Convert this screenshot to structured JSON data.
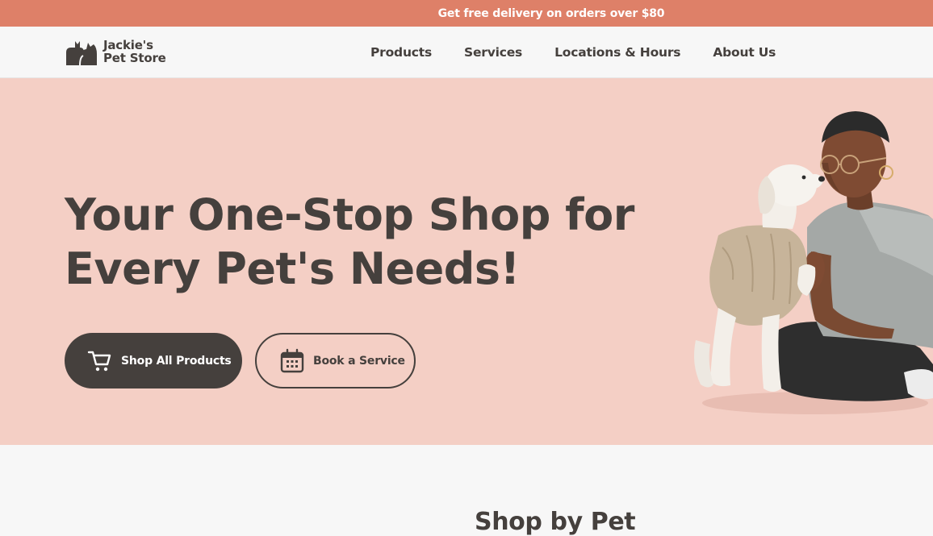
{
  "promo": {
    "text": "Get free delivery on orders over $80"
  },
  "header": {
    "logo": {
      "line1": "Jackie's",
      "line2": "Pet Store",
      "icon": "cat-dog-logo-icon"
    },
    "nav": [
      {
        "label": "Products"
      },
      {
        "label": "Services"
      },
      {
        "label": "Locations & Hours"
      },
      {
        "label": "About Us"
      }
    ]
  },
  "hero": {
    "title_line1": "Your One-Stop Shop for",
    "title_line2": "Every Pet's Needs!",
    "primary_button": {
      "label": "Shop All Products",
      "icon": "shopping-cart-icon"
    },
    "secondary_button": {
      "label": "Book a Service",
      "icon": "calendar-icon"
    },
    "illustration": "person-with-dog-in-sweater"
  },
  "sections": {
    "shop_by_pet_title": "Shop by Pet"
  },
  "colors": {
    "promo_bg": "#de8068",
    "hero_bg": "#f4cfc5",
    "text_dark": "#45403d",
    "page_bg": "#f7f7f7"
  }
}
